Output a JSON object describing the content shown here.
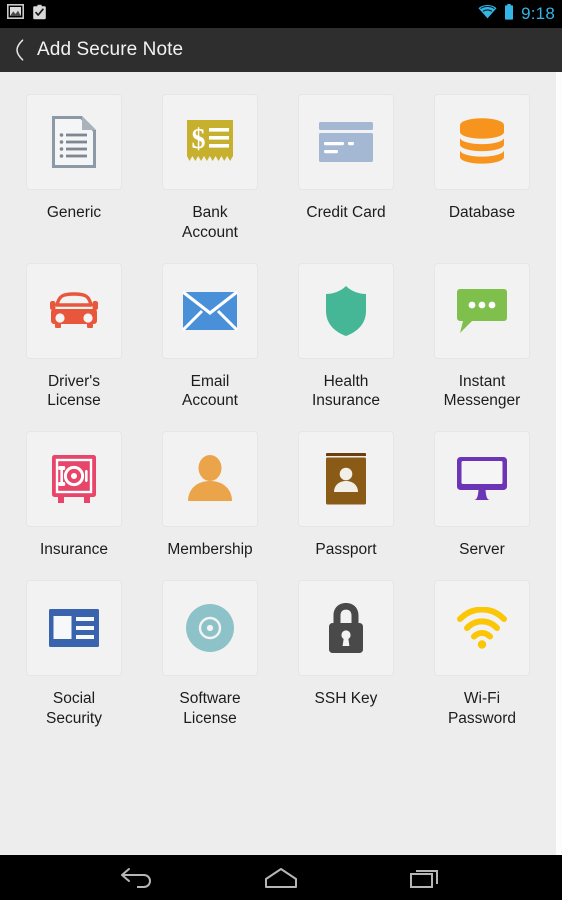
{
  "status_bar": {
    "left_icons": [
      {
        "name": "screenshot-image-icon"
      },
      {
        "name": "app-install-clipboard-icon"
      }
    ],
    "right_icons": [
      {
        "name": "wifi-icon"
      },
      {
        "name": "battery-icon"
      }
    ],
    "clock": "9:18",
    "accent_color": "#33b5e5",
    "background_color": "#000000"
  },
  "action_bar": {
    "back_label": "‹",
    "title": "Add Secure Note",
    "background_color": "#2e2e2e",
    "text_color": "#f2f2f2"
  },
  "note_types": [
    {
      "label": "Generic",
      "icon": "document-icon",
      "color": "#8e99a6"
    },
    {
      "label": "Bank\nAccount",
      "icon": "receipt-dollar-icon",
      "color": "#c8b02f"
    },
    {
      "label": "Credit Card",
      "icon": "credit-card-icon",
      "color": "#a4b8d3"
    },
    {
      "label": "Database",
      "icon": "database-icon",
      "color": "#f7941e"
    },
    {
      "label": "Driver's\nLicense",
      "icon": "car-icon",
      "color": "#e8563c"
    },
    {
      "label": "Email\nAccount",
      "icon": "envelope-icon",
      "color": "#4a90d9"
    },
    {
      "label": "Health\nInsurance",
      "icon": "shield-icon",
      "color": "#46b796"
    },
    {
      "label": "Instant\nMessenger",
      "icon": "chat-bubble-icon",
      "color": "#7ec04b"
    },
    {
      "label": "Insurance",
      "icon": "safe-icon",
      "color": "#e8456a"
    },
    {
      "label": "Membership",
      "icon": "person-icon",
      "color": "#eba44a"
    },
    {
      "label": "Passport",
      "icon": "passport-book-icon",
      "color": "#8a5a17"
    },
    {
      "label": "Server",
      "icon": "monitor-icon",
      "color": "#6b35b5"
    },
    {
      "label": "Social\nSecurity",
      "icon": "id-card-icon",
      "color": "#3a63ae"
    },
    {
      "label": "Software\nLicense",
      "icon": "disc-icon",
      "color": "#8dc2c8"
    },
    {
      "label": "SSH Key",
      "icon": "padlock-icon",
      "color": "#494949"
    },
    {
      "label": "Wi-Fi\nPassword",
      "icon": "wifi-signal-icon",
      "color": "#fbc606"
    }
  ],
  "nav_bar": {
    "buttons": [
      {
        "name": "back-nav-button"
      },
      {
        "name": "home-nav-button"
      },
      {
        "name": "recents-nav-button"
      }
    ],
    "background_color": "#000000"
  }
}
